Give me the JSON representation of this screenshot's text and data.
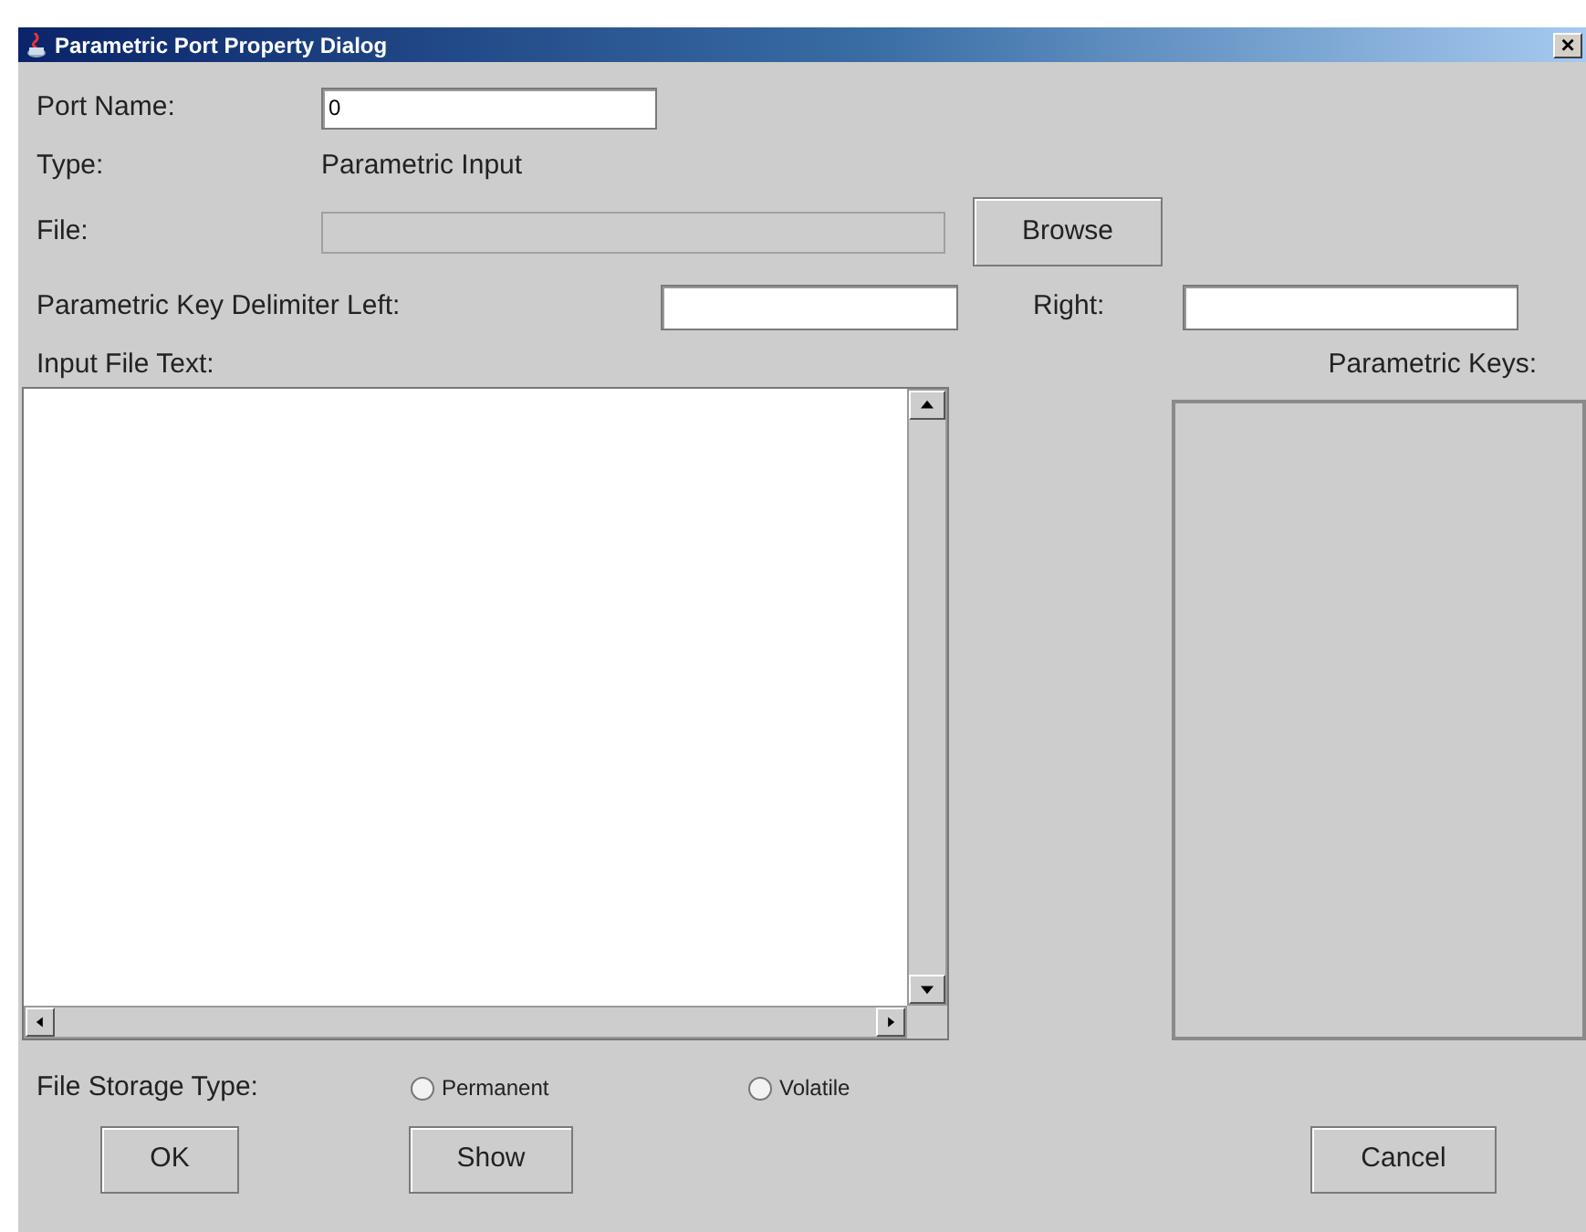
{
  "window": {
    "title": "Parametric Port Property Dialog",
    "close": "×"
  },
  "port_name": {
    "label": "Port Name:",
    "value": "0"
  },
  "type": {
    "label": "Type:",
    "value": "Parametric Input"
  },
  "file": {
    "label": "File:",
    "disabled": true,
    "button": "Browse"
  },
  "delimiter": {
    "left_label": "Parametric Key Delimiter Left:",
    "right_label": "Right:"
  },
  "input_file_text": {
    "label": "Input File Text:"
  },
  "parametric_keys": {
    "label": "Parametric Keys:"
  },
  "storage": {
    "label": "File Storage Type:",
    "options": [
      {
        "label": "Permanent",
        "selected": false
      },
      {
        "label": "Volatile",
        "selected": false
      }
    ]
  },
  "buttons": [
    {
      "label": "OK",
      "kind": "left"
    },
    {
      "label": "Show",
      "kind": "left"
    },
    {
      "label": "Cancel",
      "kind": "right"
    }
  ]
}
